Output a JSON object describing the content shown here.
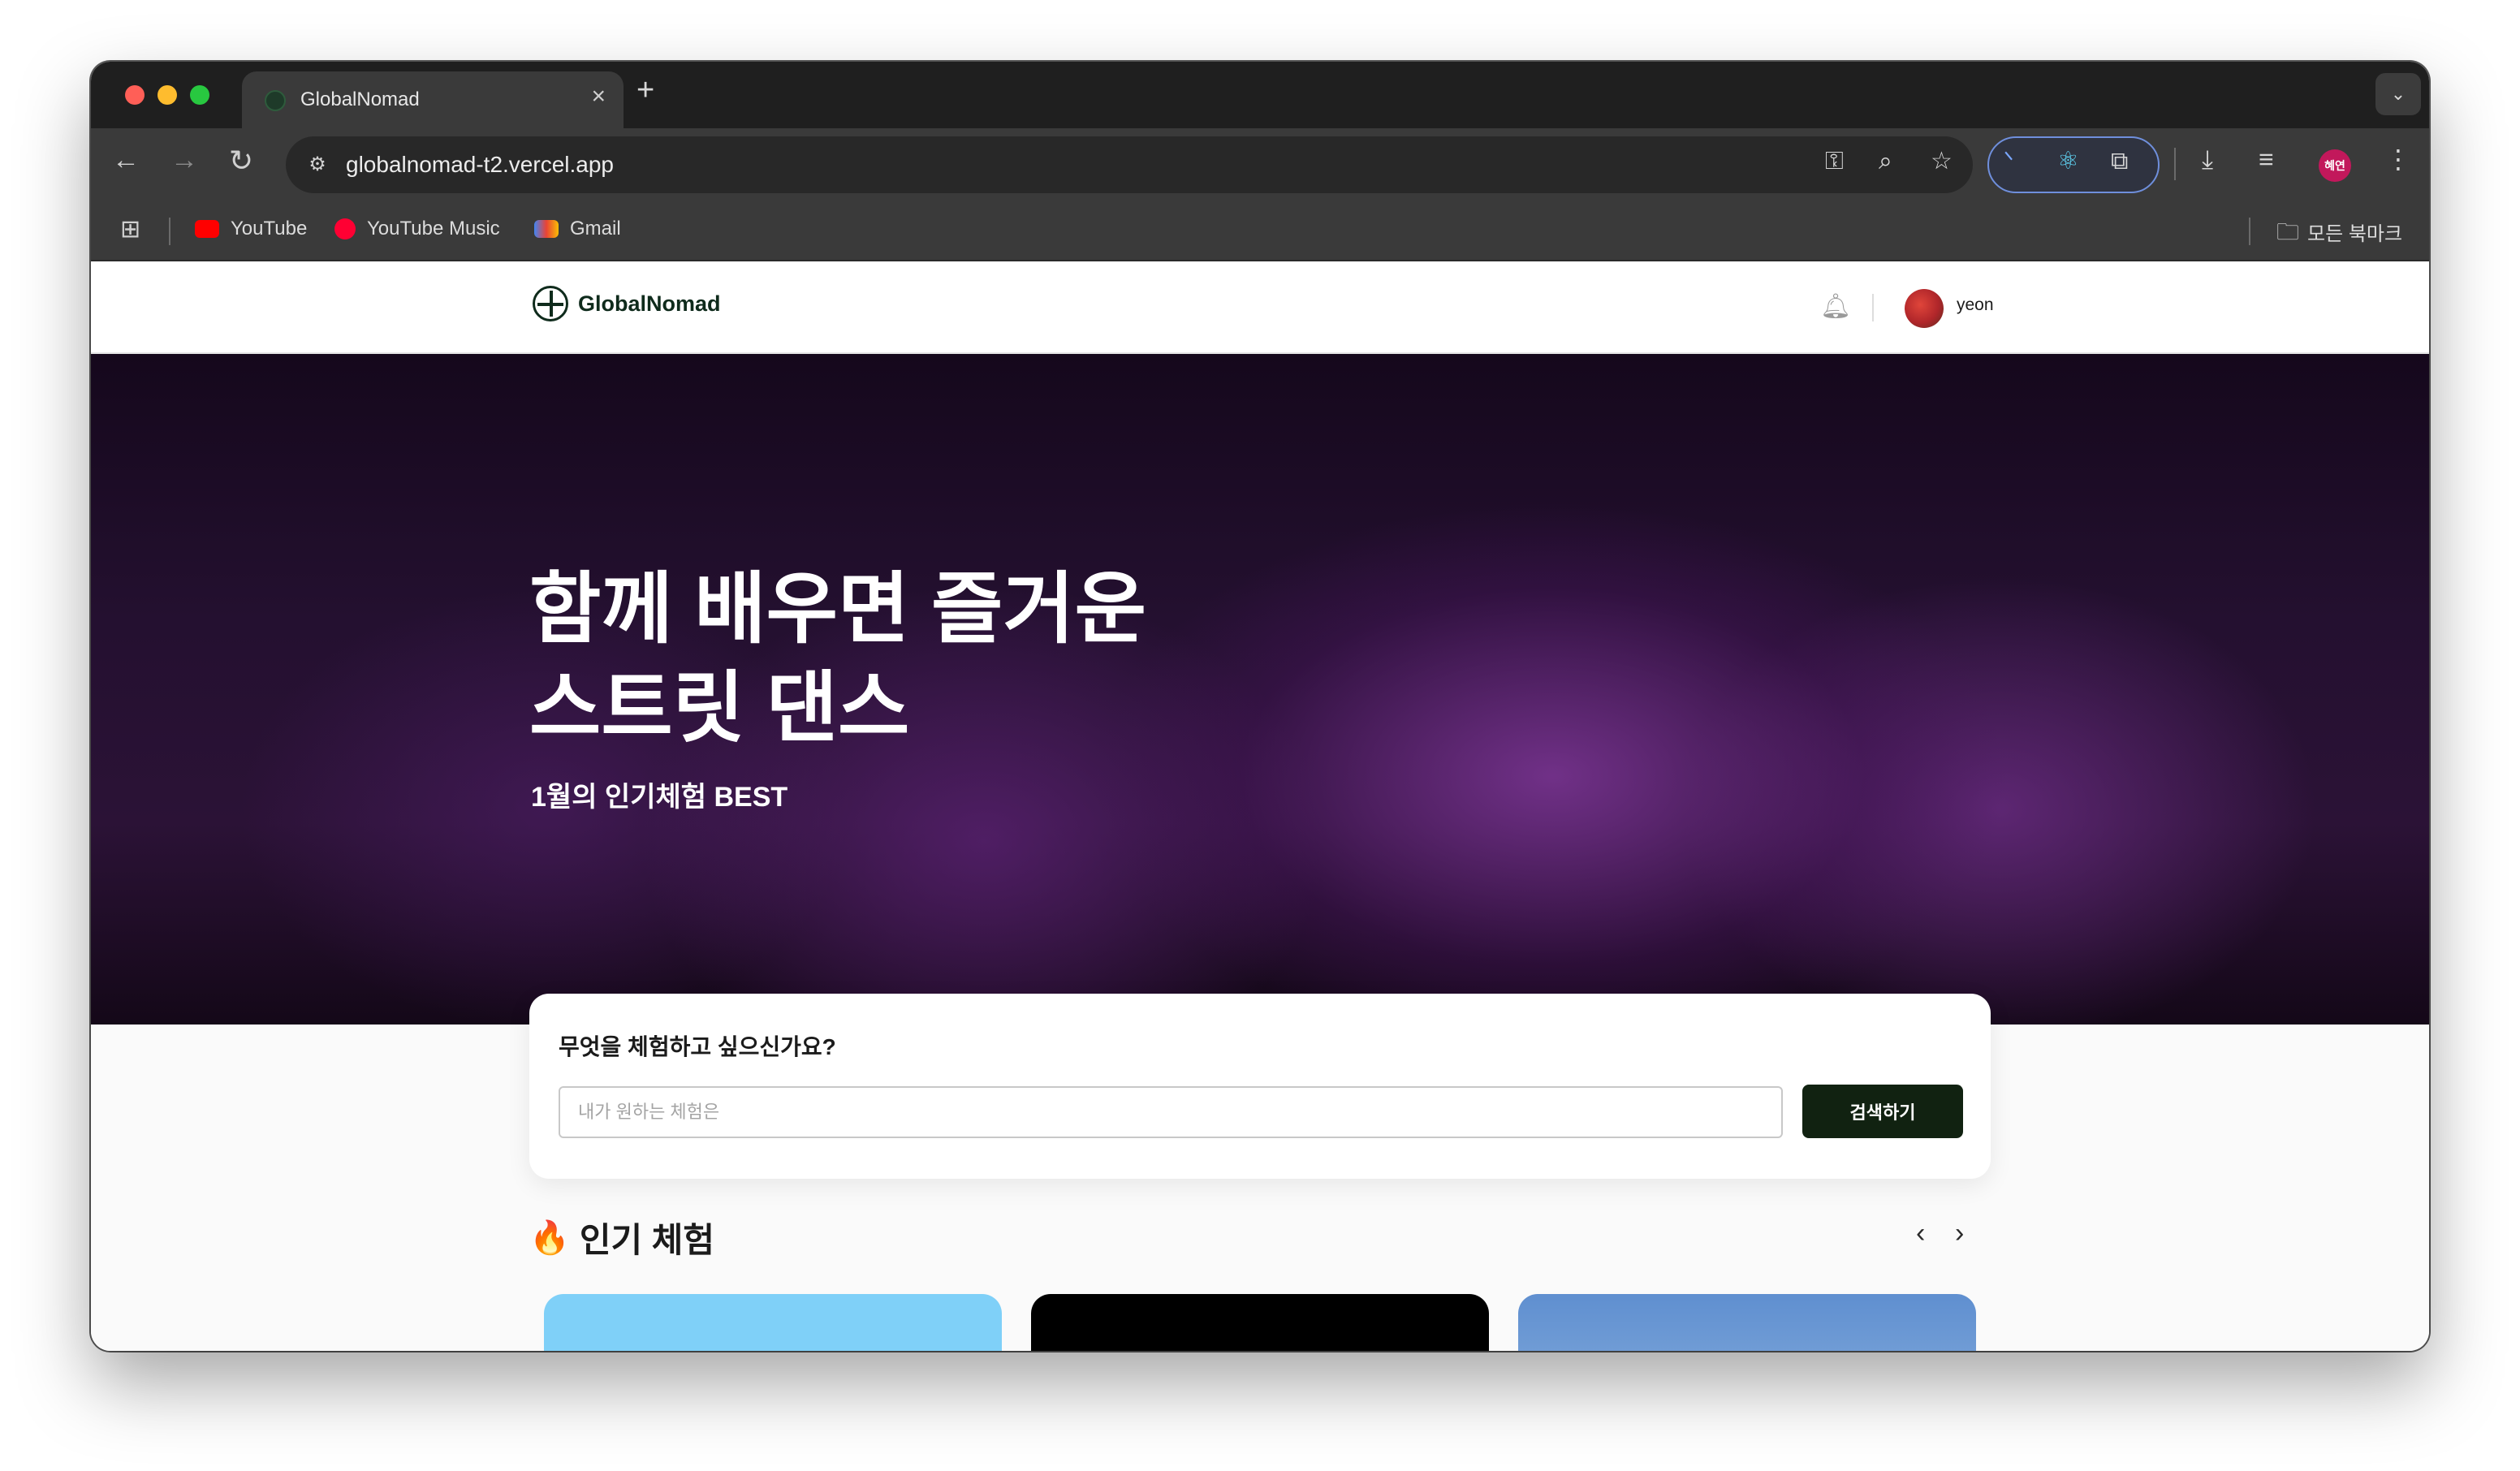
{
  "browser": {
    "tab_title": "GlobalNomad",
    "url": "globalnomad-t2.vercel.app",
    "profile_initials": "혜연",
    "bookmarks": [
      {
        "label": "YouTube",
        "color": "#ff0000"
      },
      {
        "label": "YouTube Music",
        "color": "#ff0033"
      },
      {
        "label": "Gmail",
        "color": "#ea4335"
      }
    ],
    "all_bookmarks_label": "모든 북마크"
  },
  "header": {
    "logo_text": "GlobalNomad",
    "username": "yeon"
  },
  "hero": {
    "title_line1": "함께 배우면 즐거운",
    "title_line2": "스트릿 댄스",
    "subtitle": "1월의 인기체험 BEST"
  },
  "search": {
    "question": "무엇을 체험하고 싶으신가요?",
    "placeholder": "내가 원하는 체험은",
    "value": "",
    "button_label": "검색하기"
  },
  "popular": {
    "title": "인기 체험",
    "cards": [
      {
        "color": "#7fd0f8"
      },
      {
        "color": "#000000"
      },
      {
        "color": "#6a97d4"
      }
    ]
  },
  "colors": {
    "brand_dark": "#112211",
    "chrome_bg": "#1f1f1f",
    "toolbar_bg": "#3a3a3a"
  }
}
